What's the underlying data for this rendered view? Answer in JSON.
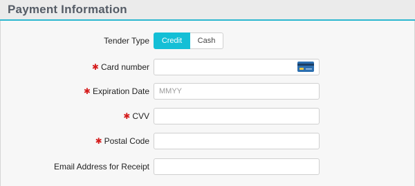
{
  "header": {
    "title": "Payment Information"
  },
  "form": {
    "tender_type": {
      "label": "Tender Type",
      "options": [
        "Credit",
        "Cash"
      ],
      "selected": "Credit"
    },
    "card_number": {
      "label": "Card number",
      "required": true,
      "value": "",
      "icon": "credit-card-icon"
    },
    "expiration_date": {
      "label": "Expiration Date",
      "required": true,
      "value": "",
      "placeholder": "MMYY"
    },
    "cvv": {
      "label": "CVV",
      "required": true,
      "value": ""
    },
    "postal_code": {
      "label": "Postal Code",
      "required": true,
      "value": ""
    },
    "email_receipt": {
      "label": "Email Address for Receipt",
      "required": false,
      "value": ""
    },
    "required_marker": "✱"
  },
  "colors": {
    "accent": "#14bfd6",
    "header_underline": "#2bb7cf",
    "required": "#d51c1c"
  }
}
